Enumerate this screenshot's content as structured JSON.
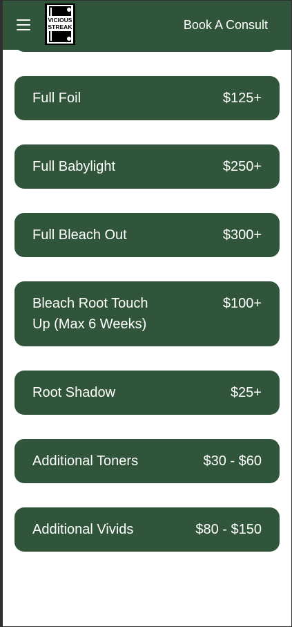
{
  "header": {
    "logo_text_top": "VICIOUS",
    "logo_text_bottom": "STREAK",
    "book_label": "Book A Consult"
  },
  "colors": {
    "brand_green": "#30553a",
    "text_on_green": "#ffffff",
    "page_background": "#ffffff"
  },
  "services": [
    {
      "name": "Full Foil",
      "price": "$125+"
    },
    {
      "name": "Full Babylight",
      "price": "$250+"
    },
    {
      "name": "Full Bleach Out",
      "price": "$300+"
    },
    {
      "name": "Bleach Root Touch Up (Max 6 Weeks)",
      "price": "$100+"
    },
    {
      "name": "Root Shadow",
      "price": "$25+"
    },
    {
      "name": "Additional Toners",
      "price": "$30 - $60"
    },
    {
      "name": "Additional Vivids",
      "price": "$80 - $150"
    }
  ]
}
